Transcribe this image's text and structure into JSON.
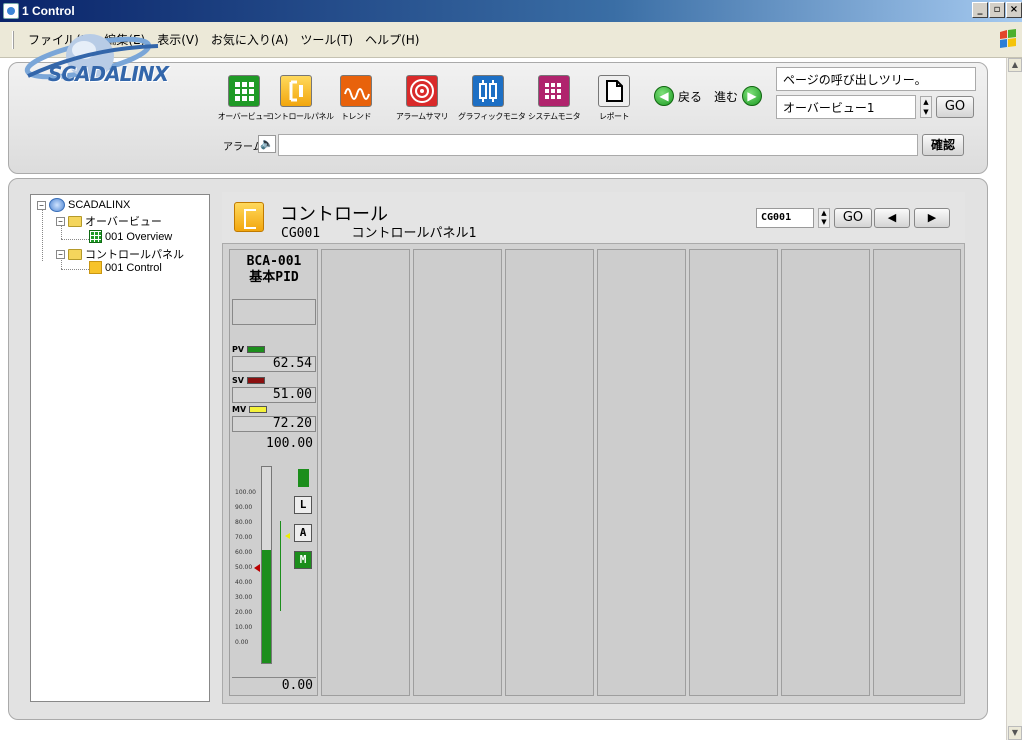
{
  "window": {
    "title": "1 Control"
  },
  "menu": [
    "ファイル(F)",
    "編集(E)",
    "表示(V)",
    "お気に入り(A)",
    "ツール(T)",
    "ヘルプ(H)"
  ],
  "header": {
    "logo_text": "SCADALINX",
    "toolbar": [
      {
        "label": "オーバービュー",
        "icon": "overview-grid-icon",
        "color": "#1f9a26"
      },
      {
        "label": "コントロールパネル",
        "icon": "control-panel-icon",
        "color": "#f2a60d"
      },
      {
        "label": "トレンド",
        "icon": "trend-wave-icon",
        "color": "#e8620b"
      },
      {
        "label": "アラームサマリ",
        "icon": "alarm-target-icon",
        "color": "#d92a2a"
      },
      {
        "label": "グラフィックモニタ",
        "icon": "graphic-monitor-icon",
        "color": "#1d6fc4"
      },
      {
        "label": "システムモニタ",
        "icon": "system-monitor-icon",
        "color": "#b0246d"
      },
      {
        "label": "レポート",
        "icon": "report-page-icon",
        "color": "#dddddd"
      }
    ],
    "back_label": "戻る",
    "forward_label": "進む",
    "tree_call": "ページの呼び出しツリー。",
    "page_select": "オーバービュー1",
    "go_label": "GO",
    "alarm_label": "アラーム",
    "confirm_label": "確認"
  },
  "tree": {
    "root": "SCADALINX",
    "overview_folder": "オーバービュー",
    "overview_item": "001 Overview",
    "control_folder": "コントロールパネル",
    "control_item": "001 Control"
  },
  "panel": {
    "title": "コントロール",
    "group_id": "CG001",
    "group_name": "コントロールパネル1",
    "group_field": "CG001",
    "go_label": "GO",
    "prev_label": "◀",
    "next_label": "▶"
  },
  "faceplate": {
    "tag": "BCA-001",
    "type": "基本PID",
    "pv_label": "PV",
    "pv_value": "62.54",
    "sv_label": "SV",
    "sv_value": "51.00",
    "mv_label": "MV",
    "mv_value": "72.20",
    "range_high": "100.00",
    "range_low": "0.00",
    "scale": [
      "100.00",
      "90.00",
      "80.00",
      "70.00",
      "60.00",
      "50.00",
      "40.00",
      "30.00",
      "20.00",
      "10.00",
      "0.00"
    ],
    "pv_level": 0.6254,
    "sv_level": 0.51,
    "mv_level": 0.722,
    "mode_buttons": [
      "L",
      "A",
      "M"
    ],
    "colors": {
      "pv": "#1c8e1c",
      "sv": "#8b1010",
      "mv": "#f5f23a"
    }
  }
}
